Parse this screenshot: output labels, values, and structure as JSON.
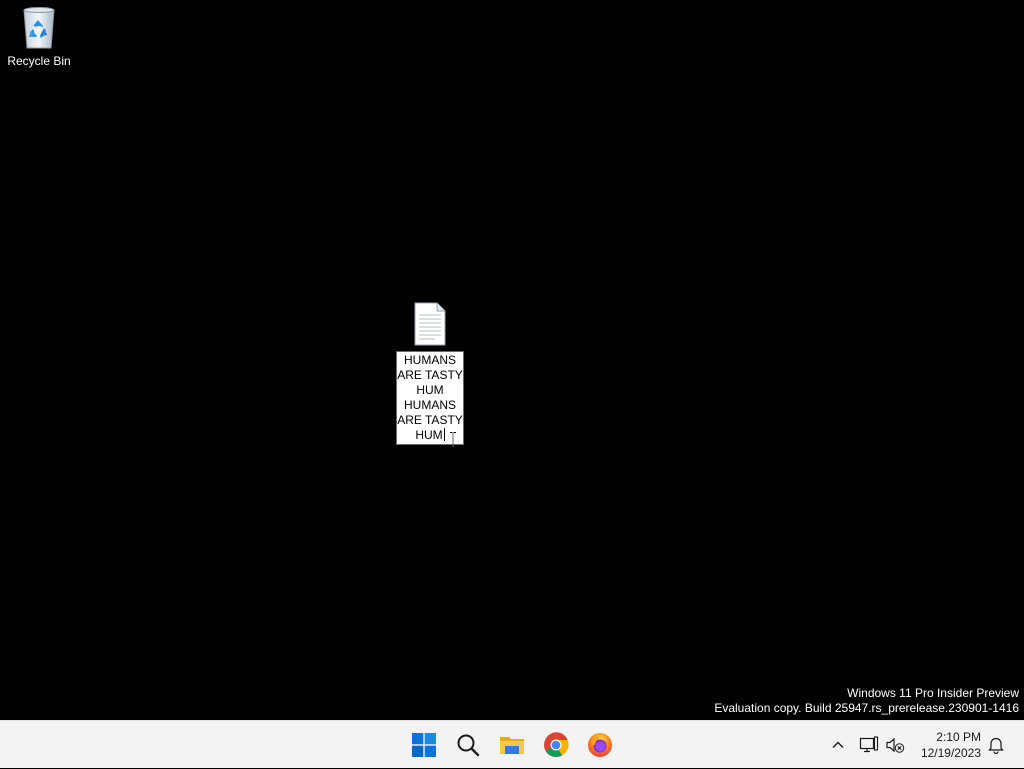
{
  "desktop": {
    "icons": [
      {
        "name": "recycle-bin",
        "label": "Recycle Bin"
      }
    ],
    "text_file": {
      "rename_lines": [
        "HUMANS",
        "ARE TASTY",
        "HUM",
        "HUMANS",
        "ARE TASTY",
        "HUM"
      ]
    }
  },
  "watermark": {
    "line1": "Windows 11 Pro Insider Preview",
    "line2": "Evaluation copy. Build 25947.rs_prerelease.230901-1416"
  },
  "taskbar": {
    "apps": [
      {
        "name": "start",
        "icon": "windows-logo"
      },
      {
        "name": "search",
        "icon": "search-icon"
      },
      {
        "name": "file-explorer",
        "icon": "folder-icon"
      },
      {
        "name": "chrome",
        "icon": "chrome-icon"
      },
      {
        "name": "firefox",
        "icon": "firefox-icon"
      }
    ],
    "tray": {
      "overflow_icon": "chevron-up-icon",
      "network_icon": "network-icon",
      "volume_icon": "volume-muted-icon",
      "notification_icon": "bell-icon"
    },
    "clock": {
      "time": "2:10 PM",
      "date": "12/19/2023"
    }
  },
  "colors": {
    "desktop_bg": "#000000",
    "taskbar_bg": "#f3f3f3",
    "start_blue": "#0078d4",
    "folder_yellow": "#f4c13d"
  }
}
